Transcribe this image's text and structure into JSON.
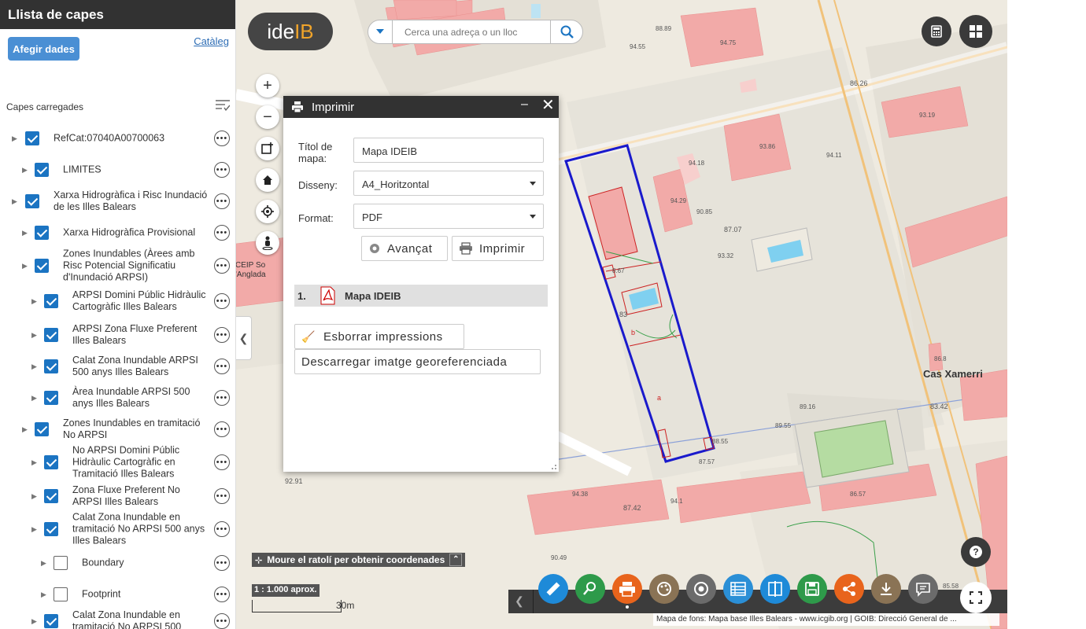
{
  "sidebar": {
    "title": "Llista de capes",
    "add_data": "Afegir dades",
    "catalog": "Catàleg",
    "loaded_label": "Capes carregades",
    "layers": [
      {
        "label": "RefCat:07040A00700063",
        "checked": true,
        "indent": 0
      },
      {
        "label": "LIMITES",
        "checked": true,
        "indent": 1
      },
      {
        "label": "Xarxa Hidrogràfica i Risc Inundació de les Illes Balears",
        "checked": true,
        "indent": 0
      },
      {
        "label": "Xarxa Hidrogràfica Provisional",
        "checked": true,
        "indent": 1
      },
      {
        "label": "Zones Inundables (Àrees amb Risc Potencial Significatiu d'Inundació ARPSI)",
        "checked": true,
        "indent": 1
      },
      {
        "label": "ARPSI Domini Públic Hidràulic Cartogràfic Illes Balears",
        "checked": true,
        "indent": 2
      },
      {
        "label": "ARPSI Zona Fluxe Preferent Illes Balears",
        "checked": true,
        "indent": 2
      },
      {
        "label": "Calat Zona Inundable ARPSI 500 anys Illes Balears",
        "checked": true,
        "indent": 2
      },
      {
        "label": "Àrea Inundable ARPSI 500 anys Illes Balears",
        "checked": true,
        "indent": 2
      },
      {
        "label": "Zones Inundables en tramitació No ARPSI",
        "checked": true,
        "indent": 1
      },
      {
        "label": "No ARPSI Domini Públic Hidràulic Cartogràfic en Tramitació Illes Balears",
        "checked": true,
        "indent": 2
      },
      {
        "label": "Zona Fluxe Preferent No ARPSI Illes Balears",
        "checked": true,
        "indent": 2
      },
      {
        "label": "Calat Zona Inundable en tramitació No ARPSI 500 anys Illes Balears",
        "checked": true,
        "indent": 2
      },
      {
        "label": "Boundary",
        "checked": false,
        "indent": 3
      },
      {
        "label": "Footprint",
        "checked": false,
        "indent": 3
      },
      {
        "label": "Calat Zona Inundable en tramitació No ARPSI 500",
        "checked": true,
        "indent": 2
      }
    ]
  },
  "search": {
    "placeholder": "Cerca una adreça o un lloc"
  },
  "logo": {
    "part1": "ide",
    "part2": "IB"
  },
  "print": {
    "title": "Imprimir",
    "title_label": "Títol de mapa:",
    "title_value": "Mapa IDEIB",
    "layout_label": "Disseny:",
    "layout_value": "A4_Horitzontal",
    "format_label": "Format:",
    "format_value": "PDF",
    "advanced": "Avançat",
    "print_btn": "Imprimir",
    "result_num": "1.",
    "result_name": "Mapa IDEIB",
    "clear": "Esborrar impressions",
    "download": "Descarregar imatge georeferenciada"
  },
  "map": {
    "coords_text": "Moure el ratolí per obtenir coordenades",
    "scale_text": "1 : 1.000 aprox.",
    "scale_bar_label": "30m",
    "attribution": "Mapa de fons: Mapa base Illes Balears - www.icgib.org | GOIB: Direcció General de ...",
    "place_label": "Cas Xamerri",
    "school_label": "CEIP So\n'Anglada",
    "elevations": [
      "88.89",
      "94.55",
      "94.75",
      "86.26",
      "93.19",
      "93.86",
      "94.18",
      "94.11",
      "94.29",
      "90.85",
      "87.07",
      "93.32",
      "8.67",
      "83",
      "86.8",
      "83.42",
      "89.16",
      "89.55",
      "88.55",
      "87.57",
      "94.38",
      "94.1",
      "87.42",
      "86.57",
      "90.49",
      "92.91",
      "85.58"
    ],
    "parcel_labels": [
      "b",
      "a"
    ]
  },
  "colors": {
    "accent": "#1b74c2",
    "dark": "#323232",
    "building": "#f2aaa8",
    "parcel_outline": "#1a1acc"
  }
}
